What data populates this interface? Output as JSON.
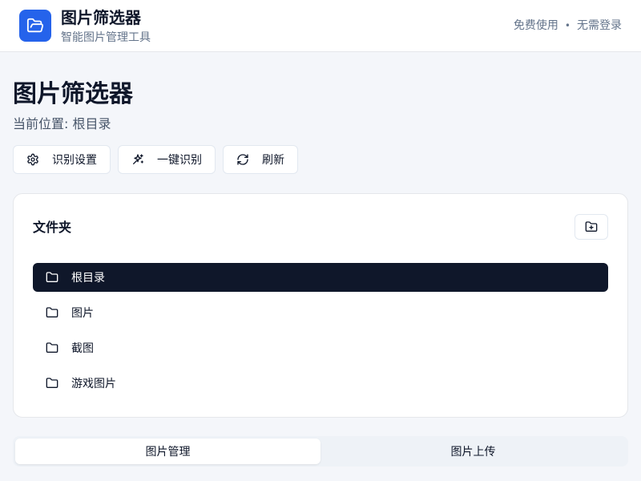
{
  "header": {
    "app_title": "图片筛选器",
    "app_subtitle": "智能图片管理工具",
    "right_text_1": "免费使用",
    "right_sep": "•",
    "right_text_2": "无需登录",
    "logo_icon": "folder-open-icon",
    "logo_color": "#2563eb"
  },
  "page": {
    "title": "图片筛选器",
    "breadcrumb": "当前位置: 根目录"
  },
  "actions": [
    {
      "label": "识别设置",
      "icon": "gear-icon"
    },
    {
      "label": "一键识别",
      "icon": "sparkles-icon"
    },
    {
      "label": "刷新",
      "icon": "refresh-icon"
    }
  ],
  "folders": {
    "title": "文件夹",
    "new_folder_icon": "folder-plus-icon",
    "items": [
      {
        "label": "根目录",
        "active": true
      },
      {
        "label": "图片",
        "active": false
      },
      {
        "label": "截图",
        "active": false
      },
      {
        "label": "游戏图片",
        "active": false
      }
    ]
  },
  "tabs": [
    {
      "label": "图片管理",
      "active": true
    },
    {
      "label": "图片上传",
      "active": false
    }
  ],
  "colors": {
    "active_item_bg": "#0f172a",
    "accent": "#2563eb"
  }
}
